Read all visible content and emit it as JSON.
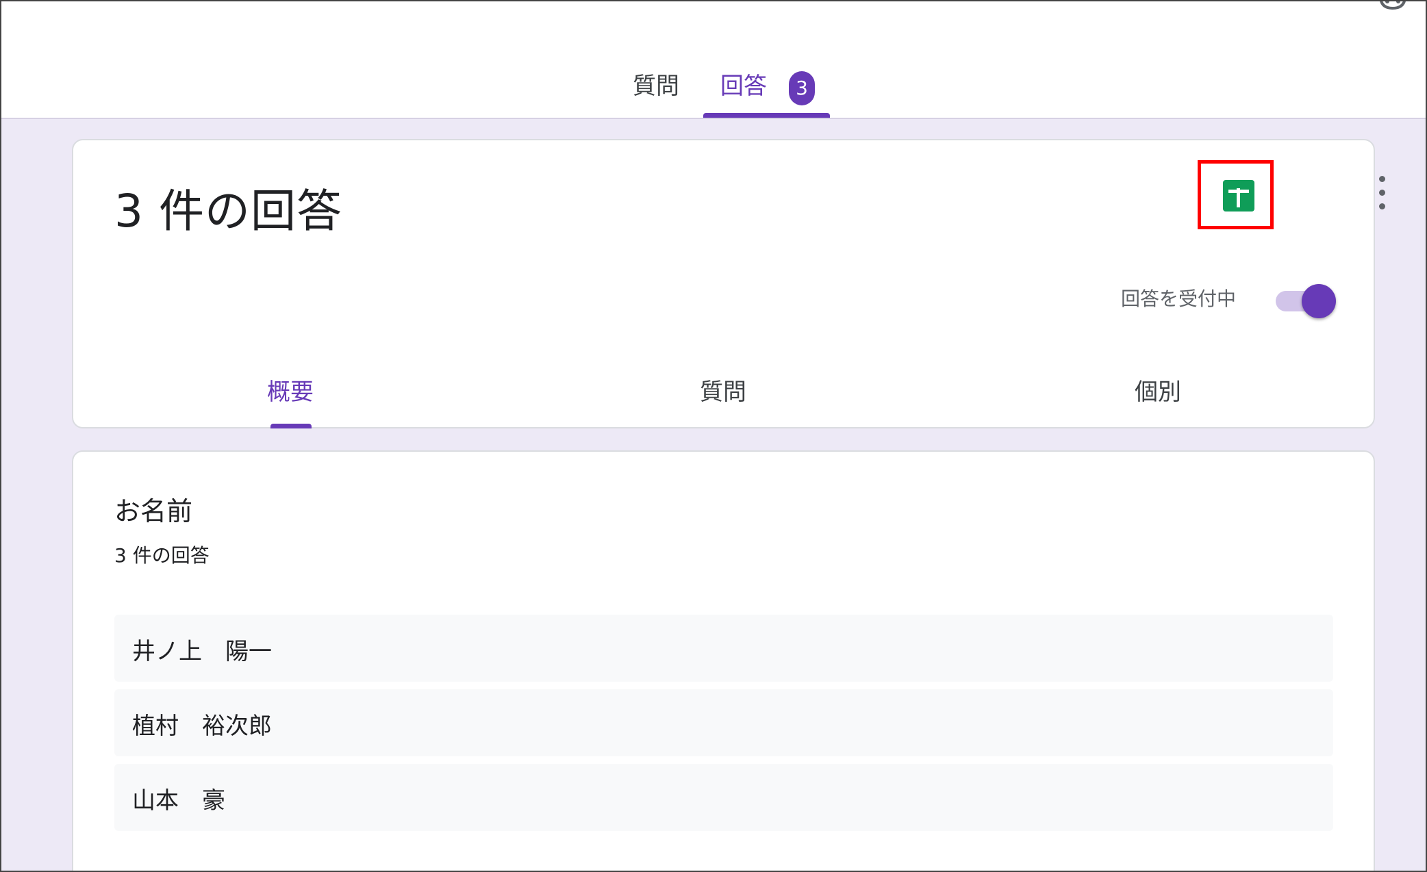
{
  "header": {
    "tabs": [
      {
        "label": "質問"
      },
      {
        "label": "回答"
      }
    ],
    "response_badge": "3"
  },
  "summary": {
    "title": "3 件の回答",
    "accepting_label": "回答を受付中",
    "accepting_on": true,
    "sheets_icon": "google-sheets-icon",
    "more_icon": "more-vert-icon",
    "sub_tabs": [
      {
        "label": "概要"
      },
      {
        "label": "質問"
      },
      {
        "label": "個別"
      }
    ]
  },
  "question": {
    "title": "お名前",
    "count_label": "3 件の回答",
    "answers": [
      "井ノ上　陽一",
      "植村　裕次郎",
      "山本　豪"
    ]
  },
  "colors": {
    "accent": "#673ab7",
    "sheets_green": "#0f9d58",
    "highlight": "#ff0000",
    "background": "#ede9f6"
  }
}
